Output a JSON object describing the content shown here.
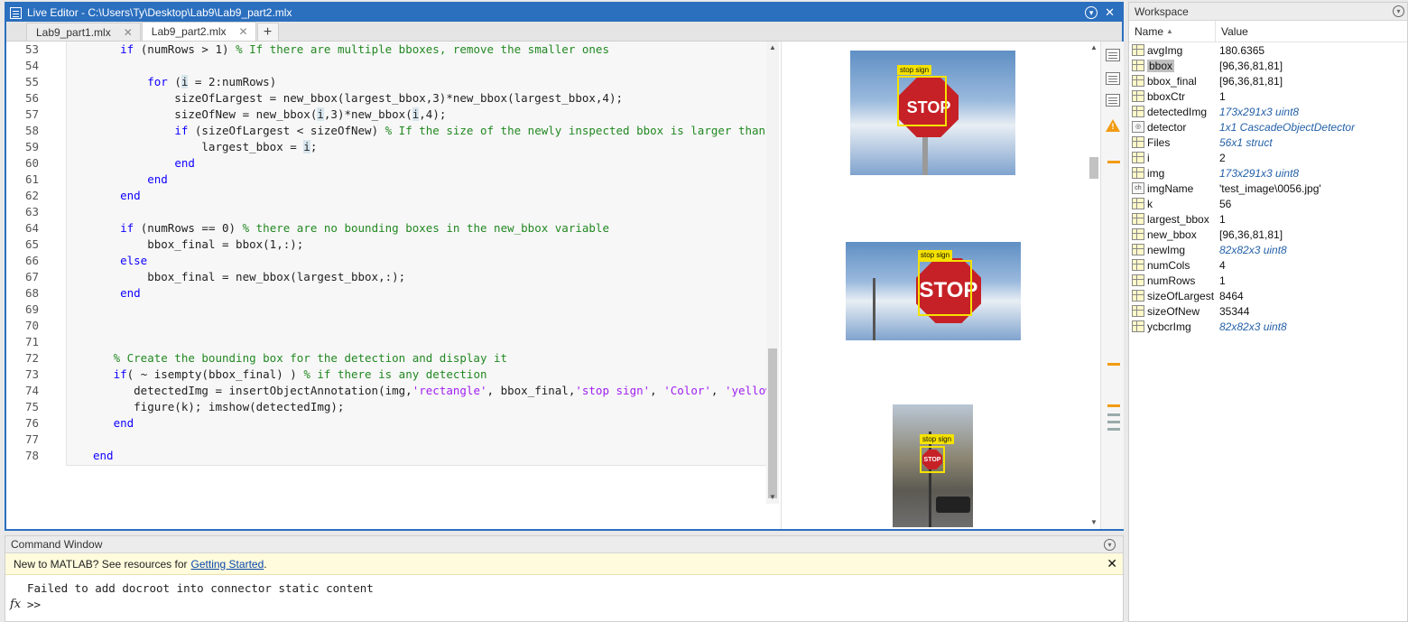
{
  "editor": {
    "title": "Live Editor - C:\\Users\\Ty\\Desktop\\Lab9\\Lab9_part2.mlx",
    "tabs": [
      {
        "label": "Lab9_part1.mlx"
      },
      {
        "label": "Lab9_part2.mlx"
      }
    ],
    "add_tab": "+",
    "code_lines": [
      {
        "n": "53",
        "html": "    <span class=\"kw\">if</span> (numRows > 1) <span class=\"cm\">% If there are multiple bboxes, remove the smaller ones</span>"
      },
      {
        "n": "54",
        "html": ""
      },
      {
        "n": "55",
        "html": "        <span class=\"kw\">for</span> (<span class=\"hl\">i</span> = 2:numRows)"
      },
      {
        "n": "56",
        "html": "            sizeOfLargest = new_bbox(largest_bbox,3)*new_bbox(largest_bbox,4);"
      },
      {
        "n": "57",
        "html": "            sizeOfNew = new_bbox(<span class=\"hl\">i</span>,3)*new_bbox(<span class=\"hl\">i</span>,4);"
      },
      {
        "n": "58",
        "html": "            <span class=\"kw\">if</span> (sizeOfLargest < sizeOfNew) <span class=\"cm\">% If the size of the newly inspected bbox is larger than</span>"
      },
      {
        "n": "59",
        "html": "                largest_bbox = <span class=\"hl\">i</span>;"
      },
      {
        "n": "60",
        "html": "            <span class=\"kw\">end</span>"
      },
      {
        "n": "61",
        "html": "        <span class=\"kw\">end</span>"
      },
      {
        "n": "62",
        "html": "    <span class=\"kw\">end</span>"
      },
      {
        "n": "63",
        "html": ""
      },
      {
        "n": "64",
        "html": "    <span class=\"kw\">if</span> (numRows == 0) <span class=\"cm\">% there are no bounding boxes in the new_bbox variable</span>"
      },
      {
        "n": "65",
        "html": "        bbox_final = bbox(1,:);"
      },
      {
        "n": "66",
        "html": "    <span class=\"kw\">else</span>"
      },
      {
        "n": "67",
        "html": "        bbox_final = new_bbox(largest_bbox,:);"
      },
      {
        "n": "68",
        "html": "    <span class=\"kw\">end</span>"
      },
      {
        "n": "69",
        "html": ""
      },
      {
        "n": "70",
        "html": ""
      },
      {
        "n": "71",
        "html": ""
      },
      {
        "n": "72",
        "html": "   <span class=\"cm\">% Create the bounding box for the detection and display it</span>"
      },
      {
        "n": "73",
        "html": "   <span class=\"kw\">if</span>( ~ isempty(bbox_final) ) <span class=\"cm\">% if there is any detection</span>"
      },
      {
        "n": "74",
        "html": "      detectedImg = insertObjectAnnotation(img,<span class=\"st\">'rectangle'</span>, bbox_final,<span class=\"st\">'stop sign'</span>, <span class=\"st\">'Color'</span>, <span class=\"st\">'yellow</span>"
      },
      {
        "n": "75",
        "html": "      figure(k); imshow(detectedImg);"
      },
      {
        "n": "76",
        "html": "   <span class=\"kw\">end</span>"
      },
      {
        "n": "77",
        "html": ""
      },
      {
        "n": "78",
        "html": "<span class=\"kw\">end</span>"
      }
    ],
    "outputs": [
      {
        "label": "stop sign",
        "sign": "STOP"
      },
      {
        "label": "stop sign",
        "sign": "STOP"
      },
      {
        "label": "stop sign",
        "sign": "STOP"
      }
    ]
  },
  "command_window": {
    "title": "Command Window",
    "notice_text": "New to MATLAB? See resources for",
    "notice_link": "Getting Started",
    "notice_end": ".",
    "output": "Failed to add docroot into connector static content",
    "prompt": ">>",
    "fx": "fx"
  },
  "workspace": {
    "title": "Workspace",
    "col_name": "Name",
    "col_value": "Value",
    "vars": [
      {
        "name": "avgImg",
        "value": "180.6365",
        "italic": false,
        "icon": "grid"
      },
      {
        "name": "bbox",
        "value": "[96,36,81,81]",
        "italic": false,
        "icon": "grid",
        "selected": true
      },
      {
        "name": "bbox_final",
        "value": "[96,36,81,81]",
        "italic": false,
        "icon": "grid"
      },
      {
        "name": "bboxCtr",
        "value": "1",
        "italic": false,
        "icon": "grid"
      },
      {
        "name": "detectedImg",
        "value": "173x291x3 uint8",
        "italic": true,
        "icon": "grid"
      },
      {
        "name": "detector",
        "value": "1x1 CascadeObjectDetector",
        "italic": true,
        "icon": "obj"
      },
      {
        "name": "Files",
        "value": "56x1 struct",
        "italic": true,
        "icon": "grid"
      },
      {
        "name": "i",
        "value": "2",
        "italic": false,
        "icon": "grid"
      },
      {
        "name": "img",
        "value": "173x291x3 uint8",
        "italic": true,
        "icon": "grid"
      },
      {
        "name": "imgName",
        "value": "'test_image\\0056.jpg'",
        "italic": false,
        "icon": "ch"
      },
      {
        "name": "k",
        "value": "56",
        "italic": false,
        "icon": "grid"
      },
      {
        "name": "largest_bbox",
        "value": "1",
        "italic": false,
        "icon": "grid"
      },
      {
        "name": "new_bbox",
        "value": "[96,36,81,81]",
        "italic": false,
        "icon": "grid"
      },
      {
        "name": "newImg",
        "value": "82x82x3 uint8",
        "italic": true,
        "icon": "grid"
      },
      {
        "name": "numCols",
        "value": "4",
        "italic": false,
        "icon": "grid"
      },
      {
        "name": "numRows",
        "value": "1",
        "italic": false,
        "icon": "grid"
      },
      {
        "name": "sizeOfLargest",
        "value": "8464",
        "italic": false,
        "icon": "grid"
      },
      {
        "name": "sizeOfNew",
        "value": "35344",
        "italic": false,
        "icon": "grid"
      },
      {
        "name": "ycbcrImg",
        "value": "82x82x3 uint8",
        "italic": true,
        "icon": "grid"
      }
    ]
  }
}
